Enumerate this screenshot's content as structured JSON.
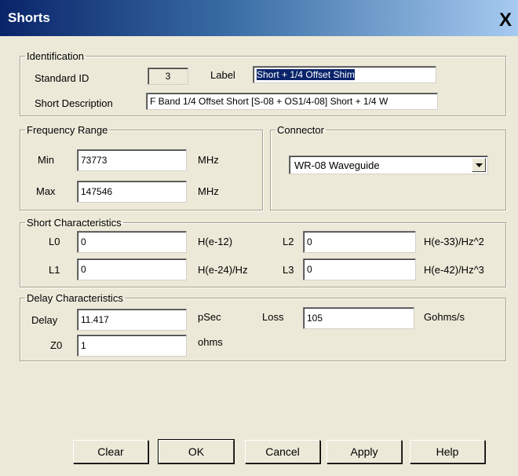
{
  "window": {
    "title": "Shorts",
    "close_glyph": "X"
  },
  "identification": {
    "legend": "Identification",
    "standard_id_label": "Standard ID",
    "standard_id_value": "3",
    "label_label": "Label",
    "label_value": "Short + 1/4 Offset Shim",
    "description_label": "Short Description",
    "description_value": "F Band 1/4 Offset Short [S-08 + OS1/4-08] Short + 1/4 W"
  },
  "frequency_range": {
    "legend": "Frequency Range",
    "min_label": "Min",
    "min_value": "73773",
    "min_unit": "MHz",
    "max_label": "Max",
    "max_value": "147546",
    "max_unit": "MHz"
  },
  "connector": {
    "legend": "Connector",
    "selected": "WR-08 Waveguide",
    "dropdown_icon": "chevron-down-icon"
  },
  "short_characteristics": {
    "legend": "Short Characteristics",
    "l0_label": "L0",
    "l0_value": "0",
    "l0_unit": "H(e-12)",
    "l1_label": "L1",
    "l1_value": "0",
    "l1_unit": "H(e-24)/Hz",
    "l2_label": "L2",
    "l2_value": "0",
    "l2_unit": "H(e-33)/Hz^2",
    "l3_label": "L3",
    "l3_value": "0",
    "l3_unit": "H(e-42)/Hz^3"
  },
  "delay_characteristics": {
    "legend": "Delay Characteristics",
    "delay_label": "Delay",
    "delay_value": "11.417",
    "delay_unit": "pSec",
    "loss_label": "Loss",
    "loss_value": "105",
    "loss_unit": "Gohms/s",
    "z0_label": "Z0",
    "z0_value": "1",
    "z0_unit": "ohms"
  },
  "buttons": {
    "clear": "Clear",
    "ok": "OK",
    "cancel": "Cancel",
    "apply": "Apply",
    "help": "Help"
  }
}
